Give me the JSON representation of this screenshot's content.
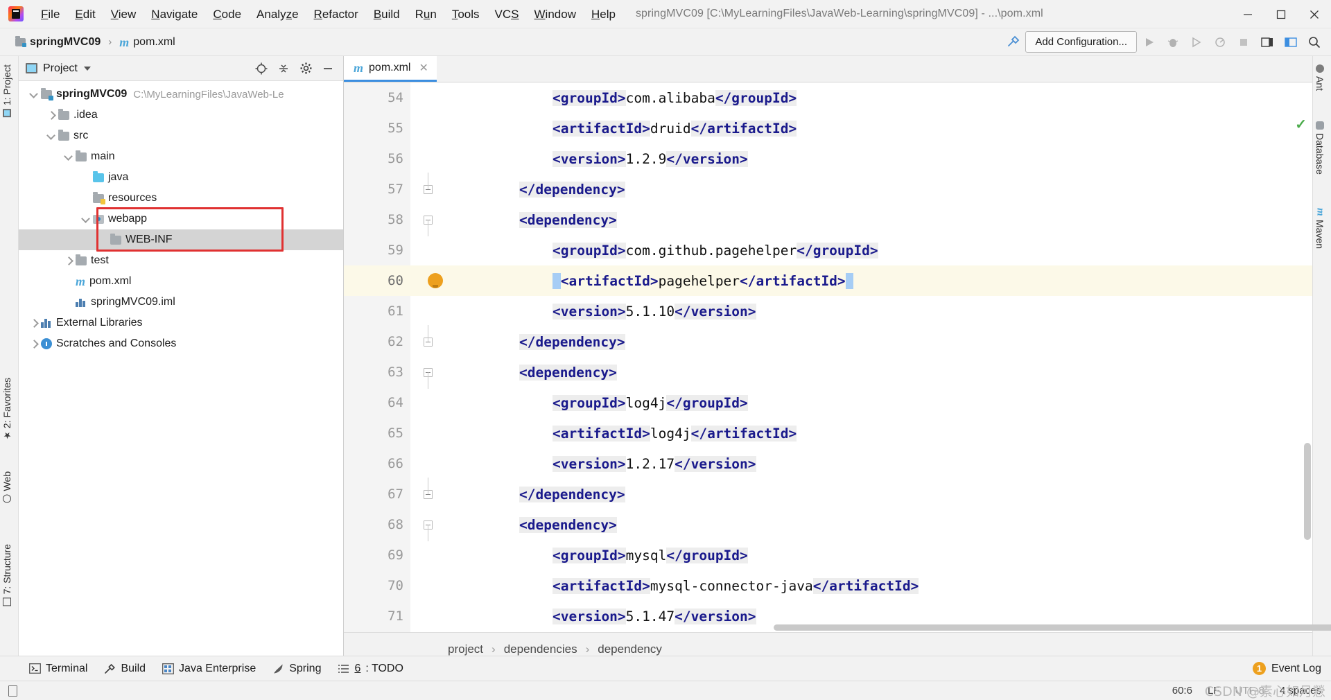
{
  "window": {
    "title": "springMVC09 [C:\\MyLearningFiles\\JavaWeb-Learning\\springMVC09] - ...\\pom.xml",
    "minimize": "—",
    "maximize": "□",
    "close": "✕"
  },
  "menu": [
    {
      "pre": "",
      "mn": "F",
      "post": "ile"
    },
    {
      "pre": "",
      "mn": "E",
      "post": "dit"
    },
    {
      "pre": "",
      "mn": "V",
      "post": "iew"
    },
    {
      "pre": "",
      "mn": "N",
      "post": "avigate"
    },
    {
      "pre": "",
      "mn": "C",
      "post": "ode"
    },
    {
      "pre": "Analy",
      "mn": "z",
      "post": "e"
    },
    {
      "pre": "",
      "mn": "R",
      "post": "efactor"
    },
    {
      "pre": "",
      "mn": "B",
      "post": "uild"
    },
    {
      "pre": "R",
      "mn": "u",
      "post": "n"
    },
    {
      "pre": "",
      "mn": "T",
      "post": "ools"
    },
    {
      "pre": "VC",
      "mn": "S",
      "post": ""
    },
    {
      "pre": "",
      "mn": "W",
      "post": "indow"
    },
    {
      "pre": "",
      "mn": "H",
      "post": "elp"
    }
  ],
  "navbar": {
    "crumbs": [
      "springMVC09",
      "pom.xml"
    ],
    "separator": "›",
    "add_configuration": "Add Configuration...",
    "icons": [
      "hammer-icon",
      "run-icon",
      "debug-icon",
      "run-coverage-icon",
      "profiler-icon",
      "stop-icon",
      "notifications-icon",
      "layout-icon",
      "search-everywhere-icon"
    ]
  },
  "left_stripe": [
    {
      "label": "1: Project",
      "icon": "project-icon"
    },
    {
      "label": "2: Favorites",
      "icon": "star-icon"
    },
    {
      "label": "Web",
      "icon": "globe-icon"
    },
    {
      "label": "7: Structure",
      "icon": "structure-icon"
    }
  ],
  "right_stripe": [
    {
      "label": "Ant",
      "icon": "ant-icon"
    },
    {
      "label": "Database",
      "icon": "database-icon"
    },
    {
      "label": "Maven",
      "icon": "maven-icon"
    }
  ],
  "project_panel": {
    "title": "Project",
    "actions": [
      "locate-icon",
      "collapse-all-icon",
      "settings-icon",
      "hide-icon"
    ],
    "tree": [
      {
        "label": "springMVC09",
        "path": "C:\\MyLearningFiles\\JavaWeb-Le",
        "arrow": "d",
        "icon": "module-folder-icon",
        "indent": 0,
        "bold": true
      },
      {
        "label": ".idea",
        "path": "",
        "arrow": "r",
        "icon": "folder-icon",
        "indent": 1,
        "bold": false
      },
      {
        "label": "src",
        "path": "",
        "arrow": "d",
        "icon": "folder-icon",
        "indent": 1,
        "bold": false
      },
      {
        "label": "main",
        "path": "",
        "arrow": "d",
        "icon": "folder-icon",
        "indent": 2,
        "bold": false
      },
      {
        "label": "java",
        "path": "",
        "arrow": "none",
        "icon": "source-folder-icon",
        "indent": 3,
        "bold": false
      },
      {
        "label": "resources",
        "path": "",
        "arrow": "none",
        "icon": "resources-folder-icon",
        "indent": 3,
        "bold": false
      },
      {
        "label": "webapp",
        "path": "",
        "arrow": "d",
        "icon": "web-folder-icon",
        "indent": 3,
        "bold": false
      },
      {
        "label": "WEB-INF",
        "path": "",
        "arrow": "none",
        "icon": "folder-icon",
        "indent": 4,
        "bold": false,
        "selected": true
      },
      {
        "label": "test",
        "path": "",
        "arrow": "r",
        "icon": "folder-icon",
        "indent": 2,
        "bold": false
      },
      {
        "label": "pom.xml",
        "path": "",
        "arrow": "none",
        "icon": "maven-file-icon",
        "indent": 2,
        "bold": false
      },
      {
        "label": "springMVC09.iml",
        "path": "",
        "arrow": "none",
        "icon": "iml-file-icon",
        "indent": 2,
        "bold": false
      },
      {
        "label": "External Libraries",
        "path": "",
        "arrow": "r",
        "icon": "libraries-icon",
        "indent": 0,
        "bold": false
      },
      {
        "label": "Scratches and Consoles",
        "path": "",
        "arrow": "r",
        "icon": "scratches-icon",
        "indent": 0,
        "bold": false
      }
    ]
  },
  "editor": {
    "tab": {
      "label": "pom.xml",
      "icon": "maven-file-icon",
      "close": "✕"
    },
    "first_line_number": 54,
    "lines": [
      {
        "n": 54,
        "fold": "",
        "bulb": false,
        "active": false,
        "indent": 8,
        "parts": [
          {
            "t": "tag",
            "v": "<groupId>",
            "hl": true
          },
          {
            "t": "txt",
            "v": "com.alibaba",
            "hl": false
          },
          {
            "t": "tag",
            "v": "</groupId>",
            "hl": true
          }
        ]
      },
      {
        "n": 55,
        "fold": "",
        "bulb": false,
        "active": false,
        "indent": 8,
        "parts": [
          {
            "t": "tag",
            "v": "<artifactId>",
            "hl": true
          },
          {
            "t": "txt",
            "v": "druid",
            "hl": false
          },
          {
            "t": "tag",
            "v": "</artifactId>",
            "hl": true
          }
        ]
      },
      {
        "n": 56,
        "fold": "",
        "bulb": false,
        "active": false,
        "indent": 8,
        "parts": [
          {
            "t": "tag",
            "v": "<version>",
            "hl": true
          },
          {
            "t": "txt",
            "v": "1.2.9",
            "hl": false
          },
          {
            "t": "tag",
            "v": "</version>",
            "hl": true
          }
        ]
      },
      {
        "n": 57,
        "fold": "end",
        "bulb": false,
        "active": false,
        "indent": 4,
        "parts": [
          {
            "t": "tag",
            "v": "</dependency>",
            "hl": true
          }
        ]
      },
      {
        "n": 58,
        "fold": "start",
        "bulb": false,
        "active": false,
        "indent": 4,
        "parts": [
          {
            "t": "tag",
            "v": "<dependency>",
            "hl": true
          }
        ]
      },
      {
        "n": 59,
        "fold": "",
        "bulb": false,
        "active": false,
        "indent": 8,
        "parts": [
          {
            "t": "tag",
            "v": "<groupId>",
            "hl": true
          },
          {
            "t": "txt",
            "v": "com.github.pagehelper",
            "hl": false
          },
          {
            "t": "tag",
            "v": "</groupId>",
            "hl": true
          }
        ]
      },
      {
        "n": 60,
        "fold": "",
        "bulb": true,
        "active": true,
        "indent": 8,
        "selected": true,
        "parts": [
          {
            "t": "tag",
            "v": "<artifactId>",
            "hl": false
          },
          {
            "t": "txt",
            "v": "pagehelper",
            "hl": false
          },
          {
            "t": "tag",
            "v": "</artifactId>",
            "hl": false
          }
        ]
      },
      {
        "n": 61,
        "fold": "",
        "bulb": false,
        "active": false,
        "indent": 8,
        "parts": [
          {
            "t": "tag",
            "v": "<version>",
            "hl": true
          },
          {
            "t": "txt",
            "v": "5.1.10",
            "hl": false
          },
          {
            "t": "tag",
            "v": "</version>",
            "hl": true
          }
        ]
      },
      {
        "n": 62,
        "fold": "end",
        "bulb": false,
        "active": false,
        "indent": 4,
        "parts": [
          {
            "t": "tag",
            "v": "</dependency>",
            "hl": true
          }
        ]
      },
      {
        "n": 63,
        "fold": "start",
        "bulb": false,
        "active": false,
        "indent": 4,
        "parts": [
          {
            "t": "tag",
            "v": "<dependency>",
            "hl": true
          }
        ]
      },
      {
        "n": 64,
        "fold": "",
        "bulb": false,
        "active": false,
        "indent": 8,
        "parts": [
          {
            "t": "tag",
            "v": "<groupId>",
            "hl": true
          },
          {
            "t": "txt",
            "v": "log4j",
            "hl": false
          },
          {
            "t": "tag",
            "v": "</groupId>",
            "hl": true
          }
        ]
      },
      {
        "n": 65,
        "fold": "",
        "bulb": false,
        "active": false,
        "indent": 8,
        "parts": [
          {
            "t": "tag",
            "v": "<artifactId>",
            "hl": true
          },
          {
            "t": "txt",
            "v": "log4j",
            "hl": false
          },
          {
            "t": "tag",
            "v": "</artifactId>",
            "hl": true
          }
        ]
      },
      {
        "n": 66,
        "fold": "",
        "bulb": false,
        "active": false,
        "indent": 8,
        "parts": [
          {
            "t": "tag",
            "v": "<version>",
            "hl": true
          },
          {
            "t": "txt",
            "v": "1.2.17",
            "hl": false
          },
          {
            "t": "tag",
            "v": "</version>",
            "hl": true
          }
        ]
      },
      {
        "n": 67,
        "fold": "end",
        "bulb": false,
        "active": false,
        "indent": 4,
        "parts": [
          {
            "t": "tag",
            "v": "</dependency>",
            "hl": true
          }
        ]
      },
      {
        "n": 68,
        "fold": "start",
        "bulb": false,
        "active": false,
        "indent": 4,
        "parts": [
          {
            "t": "tag",
            "v": "<dependency>",
            "hl": true
          }
        ]
      },
      {
        "n": 69,
        "fold": "",
        "bulb": false,
        "active": false,
        "indent": 8,
        "parts": [
          {
            "t": "tag",
            "v": "<groupId>",
            "hl": true
          },
          {
            "t": "txt",
            "v": "mysql",
            "hl": false
          },
          {
            "t": "tag",
            "v": "</groupId>",
            "hl": true
          }
        ]
      },
      {
        "n": 70,
        "fold": "",
        "bulb": false,
        "active": false,
        "indent": 8,
        "parts": [
          {
            "t": "tag",
            "v": "<artifactId>",
            "hl": true
          },
          {
            "t": "txt",
            "v": "mysql-connector-java",
            "hl": false
          },
          {
            "t": "tag",
            "v": "</artifactId>",
            "hl": true
          }
        ]
      },
      {
        "n": 71,
        "fold": "",
        "bulb": false,
        "active": false,
        "indent": 8,
        "parts": [
          {
            "t": "tag",
            "v": "<version>",
            "hl": true
          },
          {
            "t": "txt",
            "v": "5.1.47",
            "hl": false
          },
          {
            "t": "tag",
            "v": "</version>",
            "hl": true
          }
        ]
      }
    ],
    "breadcrumb": [
      "project",
      "dependencies",
      "dependency"
    ],
    "breadcrumb_separator": "›"
  },
  "bottom_bar": {
    "items": [
      {
        "label": "Terminal",
        "icon": "terminal-icon",
        "mnemonic": ""
      },
      {
        "label": "Build",
        "icon": "build-icon",
        "mnemonic": ""
      },
      {
        "label": "Java Enterprise",
        "icon": "java-enterprise-icon",
        "mnemonic": ""
      },
      {
        "label": "Spring",
        "icon": "spring-icon",
        "mnemonic": ""
      },
      {
        "label": ": TODO",
        "icon": "todo-icon",
        "mnemonic": "6"
      }
    ],
    "event_log": {
      "label": "Event Log",
      "count": "1"
    }
  },
  "status_bar": {
    "caret": "60:6",
    "line_separator": "LF",
    "encoding": "UTF-8",
    "indent": "4 spaces",
    "watermark": "CSDN @素心如月憥"
  },
  "colors": {
    "accent": "#3c8ee0",
    "tag": "#1a1a8c",
    "highlight_line": "#fcf9e8",
    "selection": "#a6cdf5",
    "redbox": "#e03131",
    "badge": "#eda01e"
  }
}
